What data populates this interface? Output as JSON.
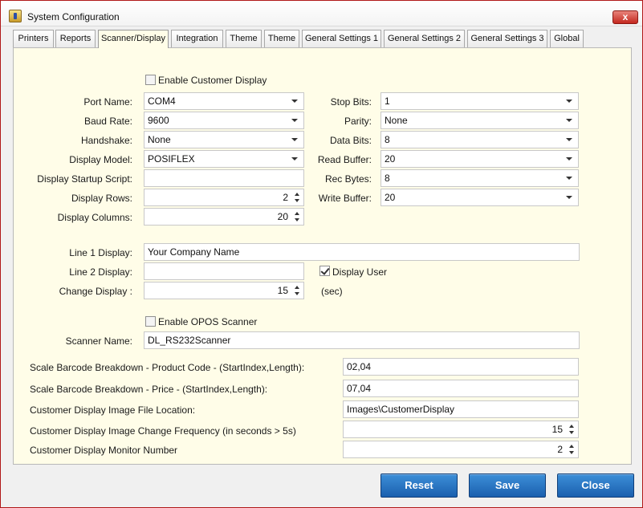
{
  "window": {
    "title": "System Configuration",
    "close_label": "x"
  },
  "tabs": [
    {
      "label": "Printers"
    },
    {
      "label": "Reports"
    },
    {
      "label": "Scanner/Display",
      "active": true
    },
    {
      "label": "Integration"
    },
    {
      "label": "Theme"
    },
    {
      "label": "Theme"
    },
    {
      "label": "General Settings 1"
    },
    {
      "label": "General Settings 2"
    },
    {
      "label": "General Settings 3"
    },
    {
      "label": "Global"
    }
  ],
  "display": {
    "enable_customer_display": {
      "label": "Enable Customer Display",
      "checked": false
    },
    "port_name": {
      "label": "Port Name:",
      "value": "COM4"
    },
    "baud_rate": {
      "label": "Baud Rate:",
      "value": "9600"
    },
    "handshake": {
      "label": "Handshake:",
      "value": "None"
    },
    "display_model": {
      "label": "Display Model:",
      "value": "POSIFLEX"
    },
    "startup_script": {
      "label": "Display Startup Script:",
      "value": ""
    },
    "display_rows": {
      "label": "Display Rows:",
      "value": "2"
    },
    "display_columns": {
      "label": "Display Columns:",
      "value": "20"
    },
    "stop_bits": {
      "label": "Stop Bits:",
      "value": "1"
    },
    "parity": {
      "label": "Parity:",
      "value": "None"
    },
    "data_bits": {
      "label": "Data Bits:",
      "value": "8"
    },
    "read_buffer": {
      "label": "Read Buffer:",
      "value": "20"
    },
    "rec_bytes": {
      "label": "Rec Bytes:",
      "value": "8"
    },
    "write_buffer": {
      "label": "Write Buffer:",
      "value": "20"
    },
    "line1": {
      "label": "Line 1 Display:",
      "value": "Your Company Name"
    },
    "line2": {
      "label": "Line 2 Display:",
      "value": ""
    },
    "display_user": {
      "label": "Display User",
      "checked": true
    },
    "change_display": {
      "label": "Change Display :",
      "value": "15",
      "unit": "(sec)"
    }
  },
  "scanner": {
    "enable_opos": {
      "label": "Enable OPOS Scanner",
      "checked": false
    },
    "scanner_name": {
      "label": "Scanner Name:",
      "value": "DL_RS232Scanner"
    }
  },
  "barcode": {
    "product_code": {
      "label": "Scale Barcode Breakdown - Product Code - (StartIndex,Length):",
      "value": "02,04"
    },
    "price": {
      "label": "Scale Barcode Breakdown - Price - (StartIndex,Length):",
      "value": "07,04"
    },
    "image_location": {
      "label": "Customer Display Image File Location:",
      "value": "Images\\CustomerDisplay"
    },
    "image_frequency": {
      "label": "Customer Display Image Change Frequency  (in seconds  > 5s)",
      "value": "15"
    },
    "monitor_number": {
      "label": "Customer Display Monitor Number",
      "value": "2"
    }
  },
  "buttons": {
    "reset": "Reset",
    "save": "Save",
    "close": "Close"
  },
  "colors": {
    "panel_bg": "#fffde8",
    "button_blue": "#1a5fae",
    "window_border": "#b01818"
  }
}
